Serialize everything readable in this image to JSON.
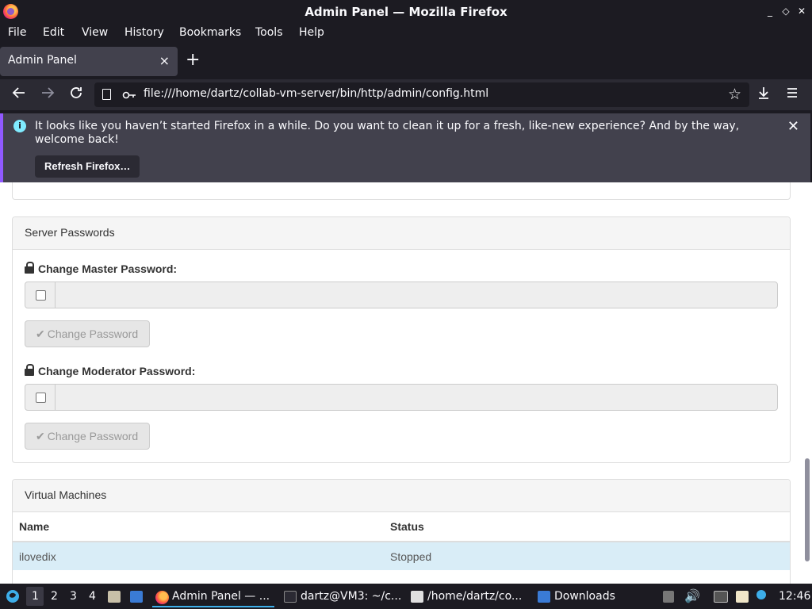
{
  "window": {
    "title": "Admin Panel — Mozilla Firefox",
    "controls": [
      "_",
      "◇",
      "✕"
    ]
  },
  "menu": {
    "items": [
      "File",
      "Edit",
      "View",
      "History",
      "Bookmarks",
      "Tools",
      "Help"
    ]
  },
  "tabs": [
    {
      "label": "Admin Panel",
      "close": "×"
    }
  ],
  "newtab_label": "+",
  "nav": {
    "url": "file:///home/dartz/collab-vm-server/bin/http/admin/config.html"
  },
  "notification": {
    "message": "It looks like you haven’t started Firefox in a while. Do you want to clean it up for a fresh, like-new experience? And by the way, welcome back!",
    "button": "Refresh Firefox…",
    "close": "✕"
  },
  "server_passwords": {
    "heading": "Server Passwords",
    "master_label": "Change Master Password:",
    "master_button": "Change Password",
    "moderator_label": "Change Moderator Password:",
    "moderator_button": "Change Password"
  },
  "virtual_machines": {
    "heading": "Virtual Machines",
    "columns": [
      "Name",
      "Status"
    ],
    "rows": [
      {
        "name": "ilovedix",
        "status": "Stopped"
      }
    ]
  },
  "taskbar": {
    "workspaces": [
      "1",
      "2",
      "3",
      "4"
    ],
    "tasks": [
      {
        "label": "Admin Panel — ...",
        "icon": "firefox-icon"
      },
      {
        "label": "dartz@VM3: ~/c...",
        "icon": "terminal-icon"
      },
      {
        "label": "/home/dartz/co...",
        "icon": "text-editor-icon"
      },
      {
        "label": "Downloads",
        "icon": "folder-icon"
      }
    ],
    "clock": "12:46"
  },
  "colors": {
    "accent": "#9059ff",
    "info": "#80ebff",
    "table_row_highlight": "#d9edf7"
  }
}
